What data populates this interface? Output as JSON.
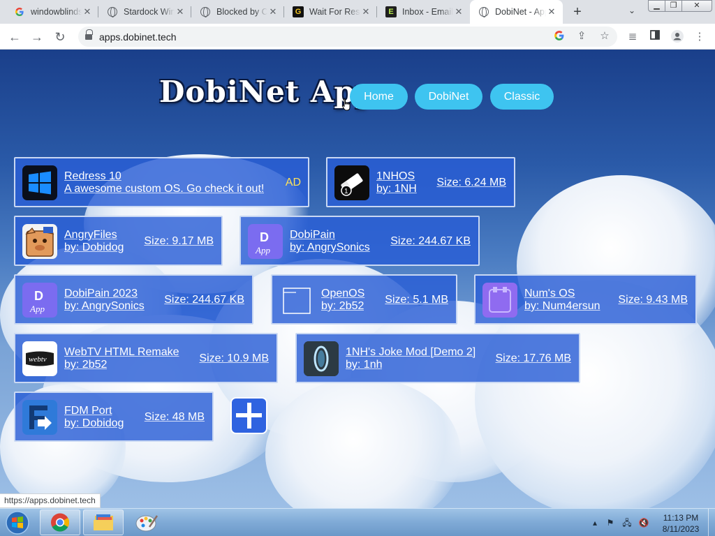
{
  "browser": {
    "tabs": [
      {
        "title": "windowblinds",
        "icon": "google-icon"
      },
      {
        "title": "Stardock WindowBlinds",
        "icon": "globe-icon"
      },
      {
        "title": "Blocked by Content Filter",
        "icon": "globe-icon"
      },
      {
        "title": "Wait For Response",
        "icon": "g-icon"
      },
      {
        "title": "Inbox - Email",
        "icon": "e-icon"
      },
      {
        "title": "DobiNet - Apps",
        "icon": "globe-icon",
        "active": true
      }
    ],
    "url": "apps.dobinet.tech",
    "status_url": "https://apps.dobinet.tech"
  },
  "site": {
    "logo": "DobiNet Apps",
    "nav": [
      "Home",
      "DobiNet",
      "Classic"
    ]
  },
  "apps": [
    {
      "name": "Redress 10",
      "by": "A awesome custom OS. Go check it out!",
      "badge": "AD",
      "icon": "windows-logo-icon"
    },
    {
      "name": "1NHOS",
      "by": "by: 1NH",
      "size": "Size: 6.24 MB",
      "icon": "eraser-icon"
    },
    {
      "name": "AngryFiles",
      "by": "by: Dobidog",
      "size": "Size: 9.17 MB",
      "icon": "angry-pig-icon"
    },
    {
      "name": "DobiPain",
      "by": "by: AngrySonics",
      "size": "Size: 244.67 KB",
      "icon": "dobipain-icon"
    },
    {
      "name": "DobiPain 2023",
      "by": "by: AngrySonics",
      "size": "Size: 244.67 KB",
      "icon": "dobipain-icon"
    },
    {
      "name": "OpenOS",
      "by": "by: 2b52",
      "size": "Size: 5.1 MB",
      "icon": "window-outline-icon"
    },
    {
      "name": "Num's OS",
      "by": "by: Num4ersun",
      "size": "Size: 9.43 MB",
      "icon": "numos-icon"
    },
    {
      "name": "WebTV HTML Remake",
      "by": "by: 2b52",
      "size": "Size: 10.9 MB",
      "icon": "webtv-icon",
      "icon_text": "webtv"
    },
    {
      "name": "1NH's Joke Mod [Demo 2]",
      "by": "by: 1nh",
      "size": "Size: 17.76 MB",
      "icon": "portal-icon"
    },
    {
      "name": "FDM Port",
      "by": "by: Dobidog",
      "size": "Size: 48 MB",
      "icon": "fdm-icon"
    }
  ],
  "taskbar": {
    "apps": [
      "chrome-icon",
      "file-explorer-icon",
      "paint-icon"
    ],
    "time": "11:13 PM",
    "date": "8/11/2023"
  }
}
